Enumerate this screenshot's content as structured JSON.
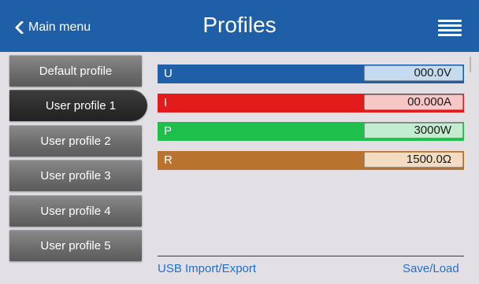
{
  "header": {
    "back_label": "Main menu",
    "title": "Profiles",
    "back_icon": "chevron-left-icon",
    "menu_icon": "hamburger-menu-icon",
    "background": "#1f5fa8"
  },
  "profiles": {
    "selected": "User profile 1",
    "items": [
      {
        "label": "Default profile"
      },
      {
        "label": "User profile 1"
      },
      {
        "label": "User profile 2"
      },
      {
        "label": "User profile 3"
      },
      {
        "label": "User profile 4"
      },
      {
        "label": "User profile 5"
      }
    ]
  },
  "values": [
    {
      "name": "U",
      "value": "000.0V",
      "bar_color": "#1f5fa8",
      "box_color": "#c5dbf0"
    },
    {
      "name": "I",
      "value": "00.000A",
      "bar_color": "#e41b1b",
      "box_color": "#f7c6c6"
    },
    {
      "name": "P",
      "value": "3000W",
      "bar_color": "#1ec04b",
      "box_color": "#c4edcf"
    },
    {
      "name": "R",
      "value": "1500.0Ω",
      "bar_color": "#b8742e",
      "box_color": "#f3dcc2"
    }
  ],
  "footer": {
    "usb_label": "USB Import/Export",
    "save_label": "Save/Load",
    "link_color": "#1f6fd0"
  }
}
